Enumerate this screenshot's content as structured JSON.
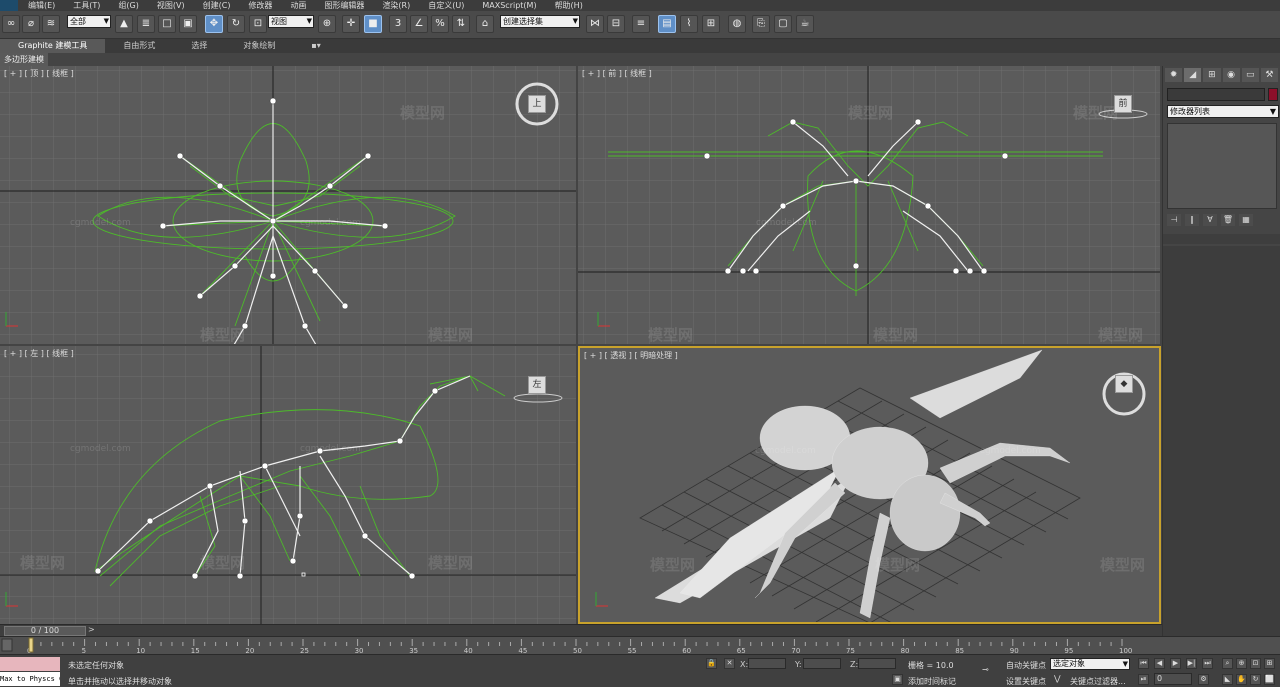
{
  "menu": [
    "编辑(E)",
    "工具(T)",
    "组(G)",
    "视图(V)",
    "创建(C)",
    "修改器",
    "动画",
    "图形编辑器",
    "渲染(R)",
    "自定义(U)",
    "MAXScript(M)",
    "帮助(H)"
  ],
  "toolbar": {
    "selection_filter": "全部",
    "reference_coord": "视图",
    "named_selection": "创建选择集"
  },
  "ribbon": {
    "tabs": [
      "Graphite 建模工具",
      "自由形式",
      "选择",
      "对象绘制"
    ],
    "panel": "多边形建模"
  },
  "viewports": {
    "top": {
      "label": "[ + ] [ 顶 ] [ 线框 ]",
      "cube": "上"
    },
    "front": {
      "label": "[ + ] [ 前 ] [ 线框 ]",
      "cube": "前"
    },
    "left": {
      "label": "[ + ] [ 左 ] [ 线框 ]",
      "cube": "左"
    },
    "perspective": {
      "label": "[ + ] [ 透视 ] [ 明暗处理 ]"
    }
  },
  "watermark": {
    "logo": "模型网",
    "url": "cgmodel.com"
  },
  "command_panel": {
    "modifier_list": "修改器列表"
  },
  "timeline": {
    "position": "0 / 100",
    "ticks": [
      "0",
      "5",
      "10",
      "15",
      "20",
      "25",
      "30",
      "35",
      "40",
      "45",
      "50",
      "55",
      "60",
      "65",
      "70",
      "75",
      "80",
      "85",
      "90",
      "95",
      "100"
    ]
  },
  "status": {
    "maxscript_text": "Max to Physcs C",
    "line1": "未选定任何对象",
    "line2": "单击并拖动以选择并移动对象",
    "x_label": "X:",
    "y_label": "Y:",
    "z_label": "Z:",
    "grid": "栅格 = 10.0",
    "add_time_tag": "添加时间标记",
    "auto_key": "自动关键点",
    "set_key": "设置关键点",
    "selected_object": "选定对象",
    "key_filters": "关键点过滤器...",
    "frame": "0"
  }
}
